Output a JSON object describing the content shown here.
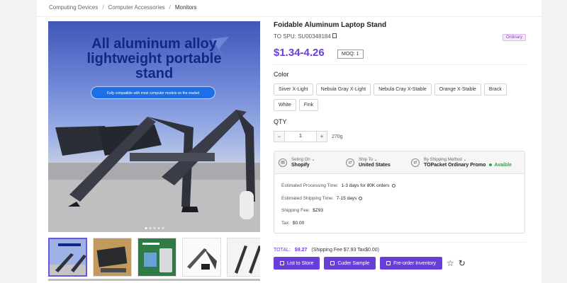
{
  "breadcrumb": [
    "Computing Devices",
    "Computer Accessories",
    "Monitors"
  ],
  "hero": {
    "headline_line1": "All aluminum alloy",
    "headline_line2": "lightweight portable",
    "headline_line3": "stand",
    "pill_text": "Fully compatible with most computer models on the market"
  },
  "product": {
    "title": "Foidable Aluminum Laptop Stand",
    "spu": "TO SPU: SU00348184",
    "badge": "Ordinary",
    "price": "$1.34-4.26",
    "moq": "MOQ: 1"
  },
  "color": {
    "label": "Color",
    "options": [
      "Siiver X-Light",
      "Nebula Gray X-Light",
      "Nebula Cray X-Stable",
      "Orange X-Stable",
      "Brack",
      "White",
      "Fink"
    ]
  },
  "quantity": {
    "label": "QTY",
    "minus": "−",
    "value": "1",
    "plus": "+",
    "weight": "270g"
  },
  "shipping": {
    "from_label": "Seting On",
    "from_value": "Shopify",
    "to_label": "Ship To",
    "to_value": "United States",
    "method_label": "By Shipping Method",
    "method_value": "TOPacket Ordinary Promo",
    "availability": "Avaible",
    "processing_label": "Estimated Processing Time:",
    "processing_value": "1-3 days for 80K orders",
    "shipping_time_label": "Estimated Shipping Time:",
    "shipping_time_value": "7-15 days",
    "fee_label": "Shipping Fee:",
    "fee_value": "$Z93",
    "tax_label": "Tax:",
    "tax_value": "$0.00"
  },
  "summary": {
    "total_label": "TOTAL:",
    "total_value": "$9.27",
    "breakdown": "(Shipping Fee $7.93  Tax$0.00)"
  },
  "actions": {
    "list_to_store": "List to Store",
    "order_sample": "Cuder Sample",
    "pre_order": "Fre-order Inventory"
  }
}
